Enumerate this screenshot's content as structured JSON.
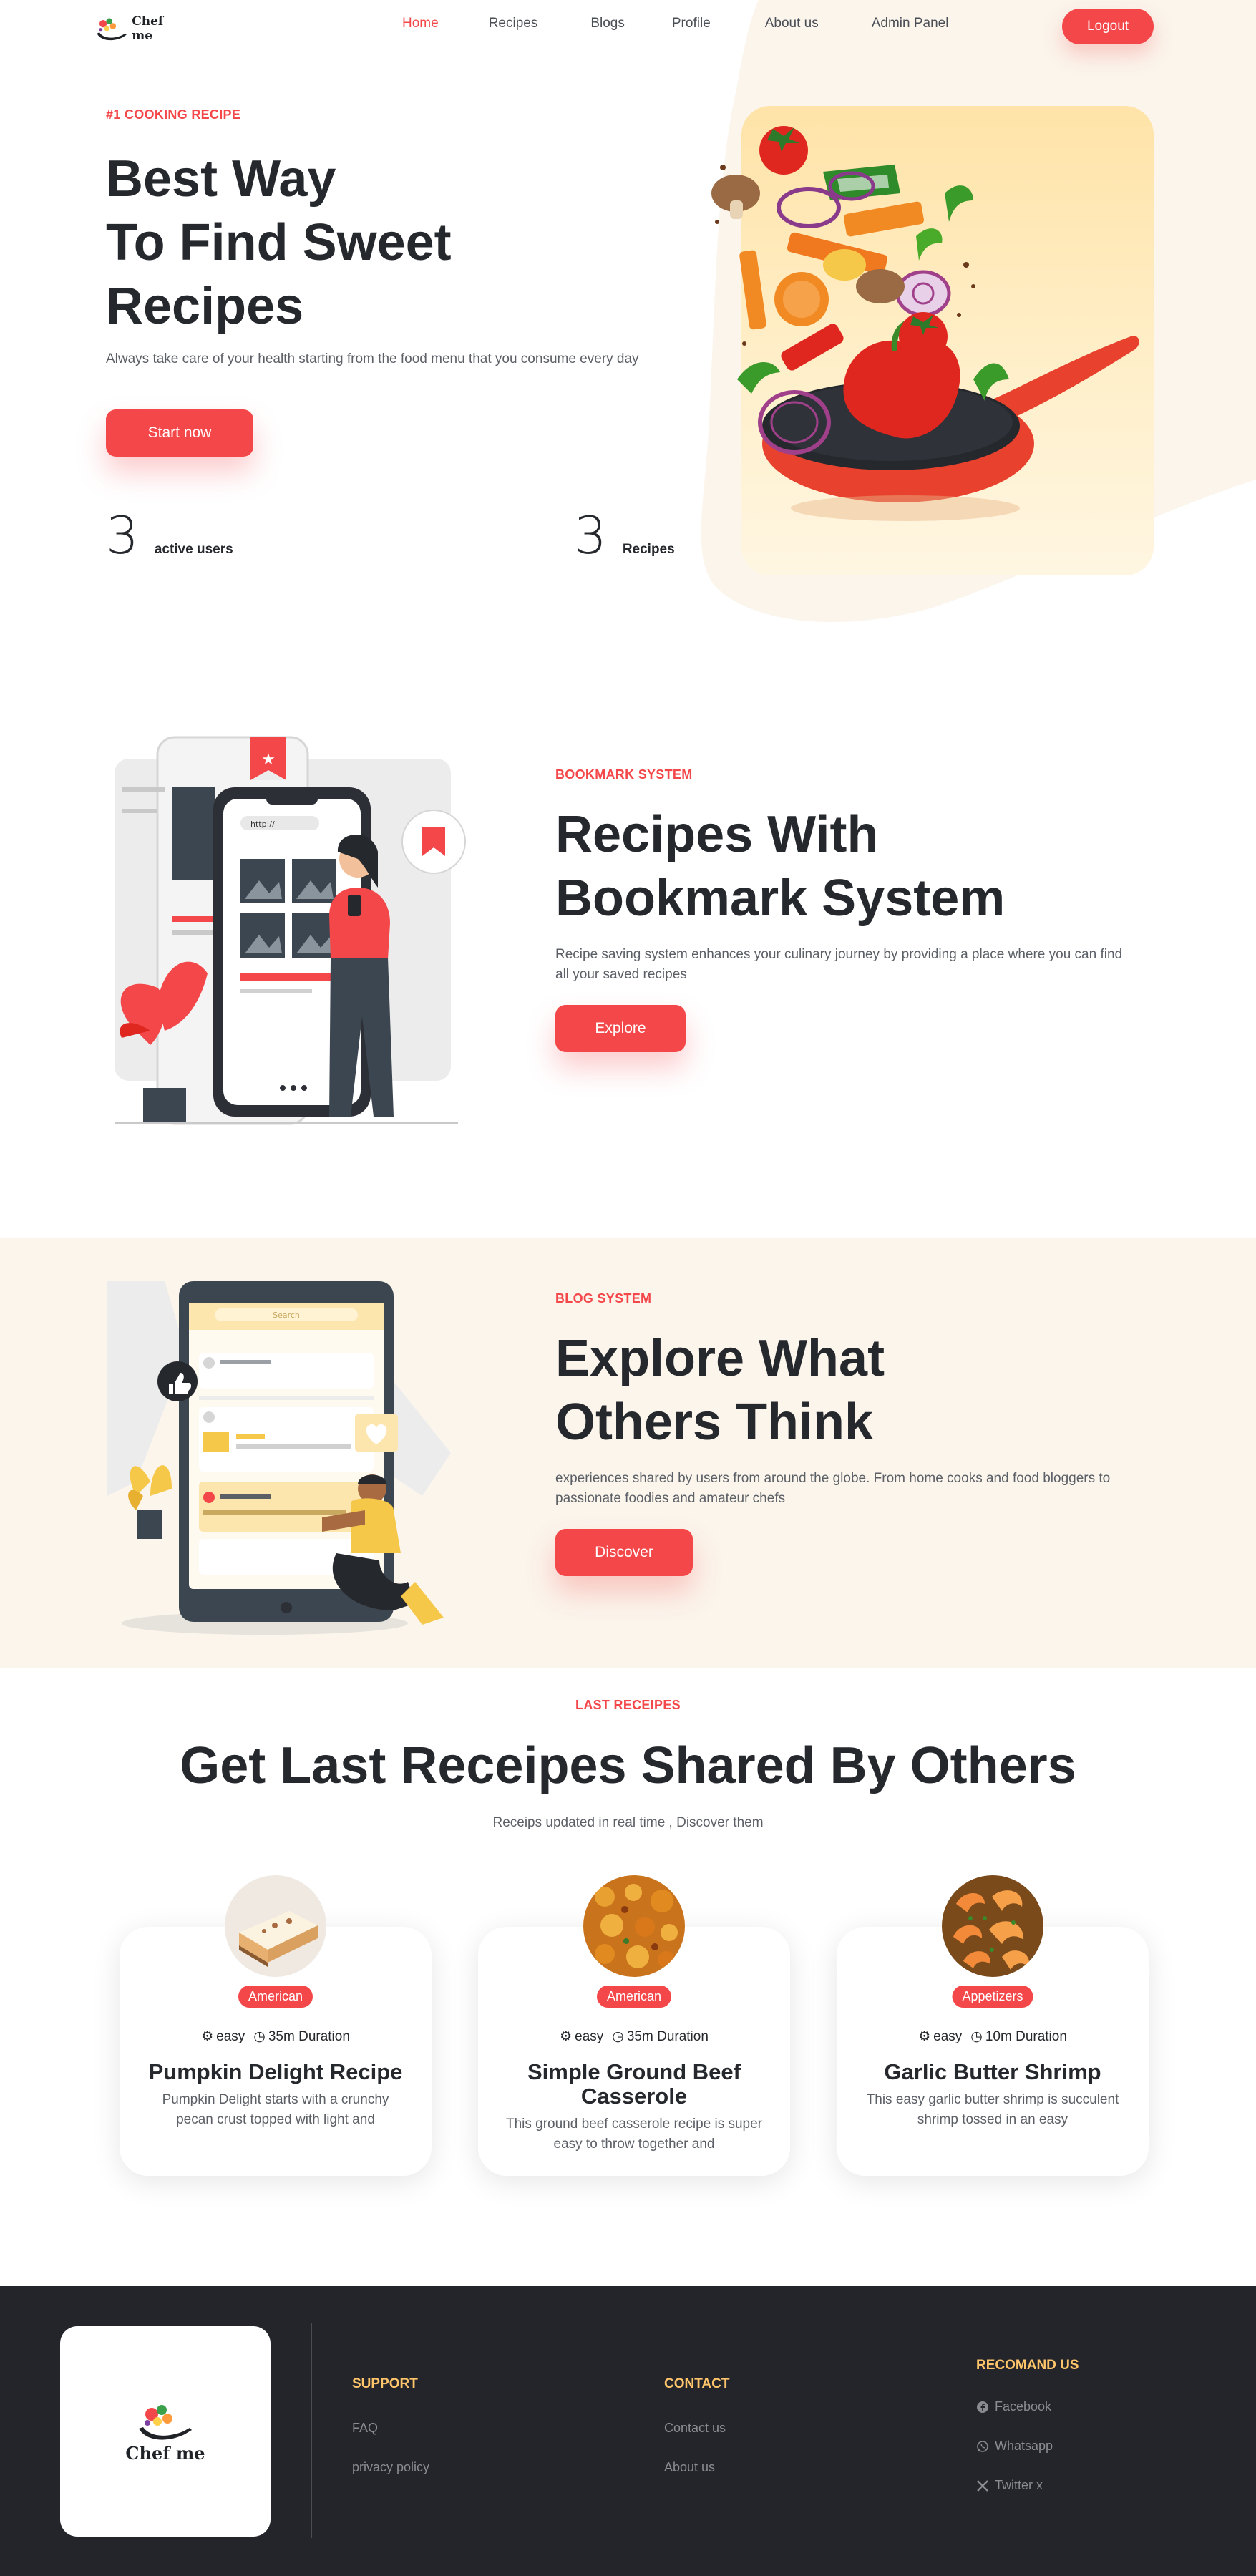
{
  "nav": {
    "brand": "Chef me",
    "links": [
      {
        "label": "Home"
      },
      {
        "label": "Recipes"
      },
      {
        "label": "Blogs"
      },
      {
        "label": "Profile"
      },
      {
        "label": "About us"
      },
      {
        "label": "Admin Panel"
      }
    ],
    "logout_label": "Logout"
  },
  "hero": {
    "eyebrow": "#1 COOKING RECIPE",
    "title_line1": "Best Way",
    "title_line2": "To Find Sweet",
    "title_line3": "Recipes",
    "subtitle": "Always take care of your health starting from the food menu that you consume every day",
    "cta": "Start now",
    "stats": [
      {
        "value": "3",
        "label": "active users"
      },
      {
        "value": "3",
        "label": "Recipes"
      }
    ]
  },
  "bookmark": {
    "eyebrow": "BOOKMARK SYSTEM",
    "title_line1": "Recipes With",
    "title_line2": "Bookmark System",
    "subtitle": "Recipe saving system enhances your culinary journey by providing a place where you can find all your saved recipes",
    "cta": "Explore",
    "phone_url": "http://"
  },
  "blog": {
    "eyebrow": "BLOG SYSTEM",
    "title_line1": "Explore What",
    "title_line2": "Others Think",
    "subtitle": "experiences shared by users from around the globe. From home cooks and food bloggers to passionate foodies and amateur chefs",
    "cta": "Discover",
    "phone_search": "Search"
  },
  "latest": {
    "eyebrow": "LAST RECEIPES",
    "title": "Get Last Receipes Shared By Others",
    "subtitle": "Receips updated in real time , Discover them",
    "cards": [
      {
        "category": "American",
        "difficulty": "easy",
        "duration": "35m Duration",
        "title": "Pumpkin Delight Recipe",
        "description": "Pumpkin Delight starts with a crunchy pecan crust topped with light and"
      },
      {
        "category": "American",
        "difficulty": "easy",
        "duration": "35m Duration",
        "title": "Simple Ground Beef Casserole",
        "description": "This ground beef casserole recipe is super easy to throw together and"
      },
      {
        "category": "Appetizers",
        "difficulty": "easy",
        "duration": "10m Duration",
        "title": "Garlic Butter Shrimp",
        "description": "This easy garlic butter shrimp is succulent shrimp tossed in an easy"
      }
    ]
  },
  "footer": {
    "brand": "Chef me",
    "support": {
      "heading": "SUPPORT",
      "links": [
        "FAQ",
        "privacy policy"
      ]
    },
    "contact": {
      "heading": "CONTACT",
      "links": [
        "Contact us",
        "About us"
      ]
    },
    "recommend": {
      "heading": "RECOMAND US",
      "links": [
        {
          "label": "Facebook",
          "icon": "facebook-icon"
        },
        {
          "label": "Whatsapp",
          "icon": "whatsapp-icon"
        },
        {
          "label": "Twitter x",
          "icon": "x-icon"
        }
      ]
    }
  },
  "colors": {
    "accent": "#f4474a",
    "dark": "#23252b",
    "cream": "#fbf5ec",
    "footer_heading": "#ffc56b"
  }
}
